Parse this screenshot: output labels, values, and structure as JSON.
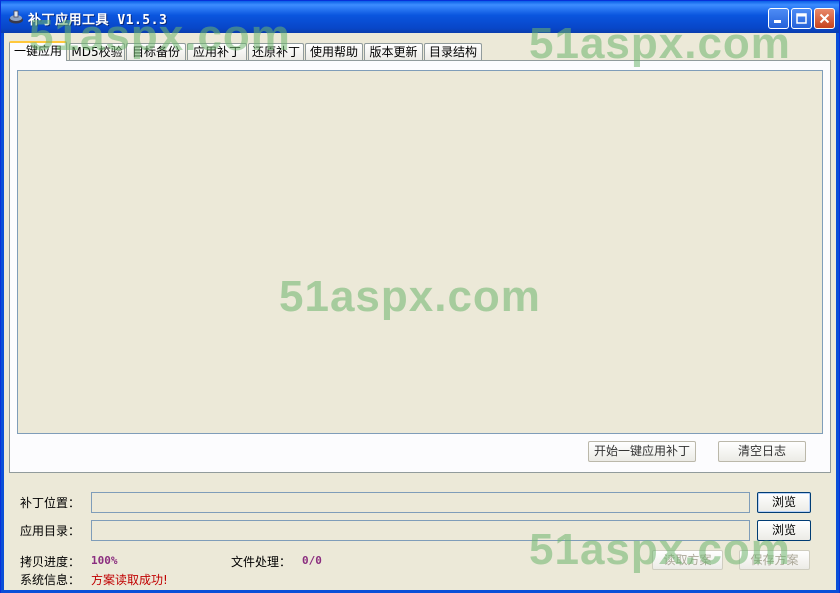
{
  "window": {
    "title": "补丁应用工具 V1.5.3",
    "icon": "gear-disk-icon",
    "accent": "#0A55DE"
  },
  "tabs": [
    {
      "label": "一键应用",
      "active": true
    },
    {
      "label": "MD5校验"
    },
    {
      "label": "目标备份"
    },
    {
      "label": "应用补丁"
    },
    {
      "label": "还原补丁"
    },
    {
      "label": "使用帮助"
    },
    {
      "label": "版本更新"
    },
    {
      "label": "目录结构"
    }
  ],
  "panel": {
    "start_button": "开始一键应用补丁",
    "clear_button": "清空日志"
  },
  "form": {
    "patch_location_label": "补丁位置：",
    "patch_location_value": "",
    "app_dir_label": "应用目录：",
    "app_dir_value": "",
    "browse1": "浏览",
    "browse2": "浏览"
  },
  "status": {
    "copy_progress_label": "拷贝进度：",
    "copy_progress_value": "100%",
    "file_process_label": "文件处理：",
    "file_process_value": "0/0",
    "system_info_label": "系统信息：",
    "system_info_value": "方案读取成功!",
    "read_plan_button": "读取方案",
    "save_plan_button": "保存方案"
  },
  "watermarks": [
    "51aspx.com",
    "51aspx.com",
    "51aspx.com",
    "51aspx.com"
  ]
}
